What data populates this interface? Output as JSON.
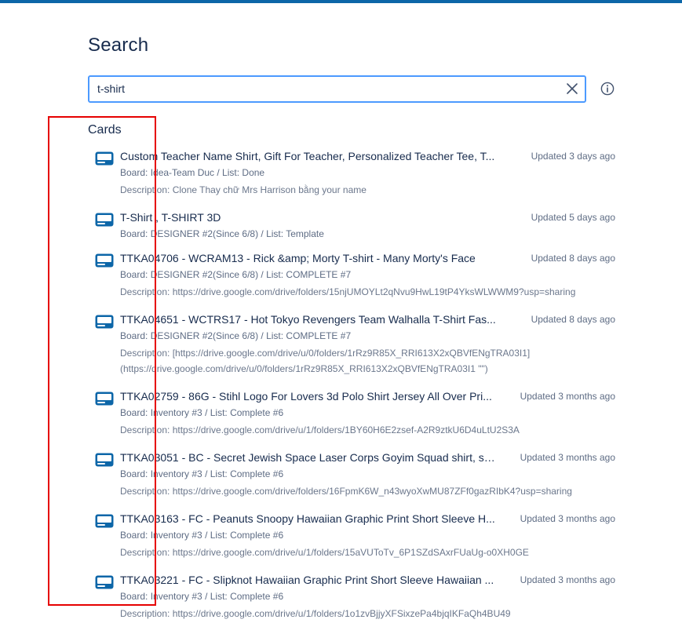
{
  "page": {
    "title": "Search",
    "accent_color": "#0c66a8",
    "highlight_color": "#e60000"
  },
  "search": {
    "value": "t-shirt",
    "clear_icon": "close-icon",
    "info_icon": "info-icon"
  },
  "sections": {
    "cards_title": "Cards"
  },
  "cards": [
    {
      "title": "Custom Teacher Name Shirt, Gift For Teacher, Personalized Teacher Tee, T...",
      "updated": "Updated 3 days ago",
      "meta": "Board: Idea-Team Duc / List: Done",
      "description": [
        "Description: Clone Thay chữ Mrs Harrison bằng your name"
      ]
    },
    {
      "title": "T-Shirt , T-SHIRT 3D",
      "updated": "Updated 5 days ago",
      "meta": "Board: DESIGNER #2(Since 6/8) / List: Template",
      "description": []
    },
    {
      "title": "TTKA04706 - WCRAM13 - Rick &amp; Morty T-shirt - Many Morty's Face",
      "updated": "Updated 8 days ago",
      "meta": "Board: DESIGNER #2(Since 6/8) / List: COMPLETE #7",
      "description": [
        "Description: https://drive.google.com/drive/folders/15njUMOYLt2qNvu9HwL19tP4YksWLWWM9?usp=sharing"
      ]
    },
    {
      "title": "TTKA04651 - WCTRS17 - Hot Tokyo Revengers Team Walhalla T-Shirt Fas...",
      "updated": "Updated 8 days ago",
      "meta": "Board: DESIGNER #2(Since 6/8) / List: COMPLETE #7",
      "description": [
        "Description: [https://drive.google.com/drive/u/0/folders/1rRz9R85X_RRI613X2xQBVfENgTRA03I1]",
        "(https://drive.google.com/drive/u/0/folders/1rRz9R85X_RRI613X2xQBVfENgTRA03I1 \"\")"
      ]
    },
    {
      "title": "TTKA02759 - 86G - Stihl Logo For Lovers 3d Polo Shirt Jersey All Over Pri...",
      "updated": "Updated 3 months ago",
      "meta": "Board: Inventory #3 / List: Complete #6",
      "description": [
        "Description: https://drive.google.com/drive/u/1/folders/1BY60H6E2zsef-A2R9ztkU6D4uLtU2S3A"
      ]
    },
    {
      "title": "TTKA03051 - BC - Secret Jewish Space Laser Corps Goyim Squad shirt, shi...",
      "updated": "Updated 3 months ago",
      "meta": "Board: Inventory #3 / List: Complete #6",
      "description": [
        "Description: https://drive.google.com/drive/folders/16FpmK6W_n43wyoXwMU87ZFf0gazRIbK4?usp=sharing"
      ]
    },
    {
      "title": "TTKA03163 - FC - Peanuts Snoopy Hawaiian Graphic Print Short Sleeve H...",
      "updated": "Updated 3 months ago",
      "meta": "Board: Inventory #3 / List: Complete #6",
      "description": [
        "Description: https://drive.google.com/drive/u/1/folders/15aVUToTv_6P1SZdSAxrFUaUg-o0XH0GE"
      ]
    },
    {
      "title": "TTKA03221 - FC - Slipknot Hawaiian Graphic Print Short Sleeve Hawaiian ...",
      "updated": "Updated 3 months ago",
      "meta": "Board: Inventory #3 / List: Complete #6",
      "description": [
        "Description: https://drive.google.com/drive/u/1/folders/1o1zvBjjyXFSixzePa4bjqIKFaQh4BU49"
      ]
    }
  ]
}
